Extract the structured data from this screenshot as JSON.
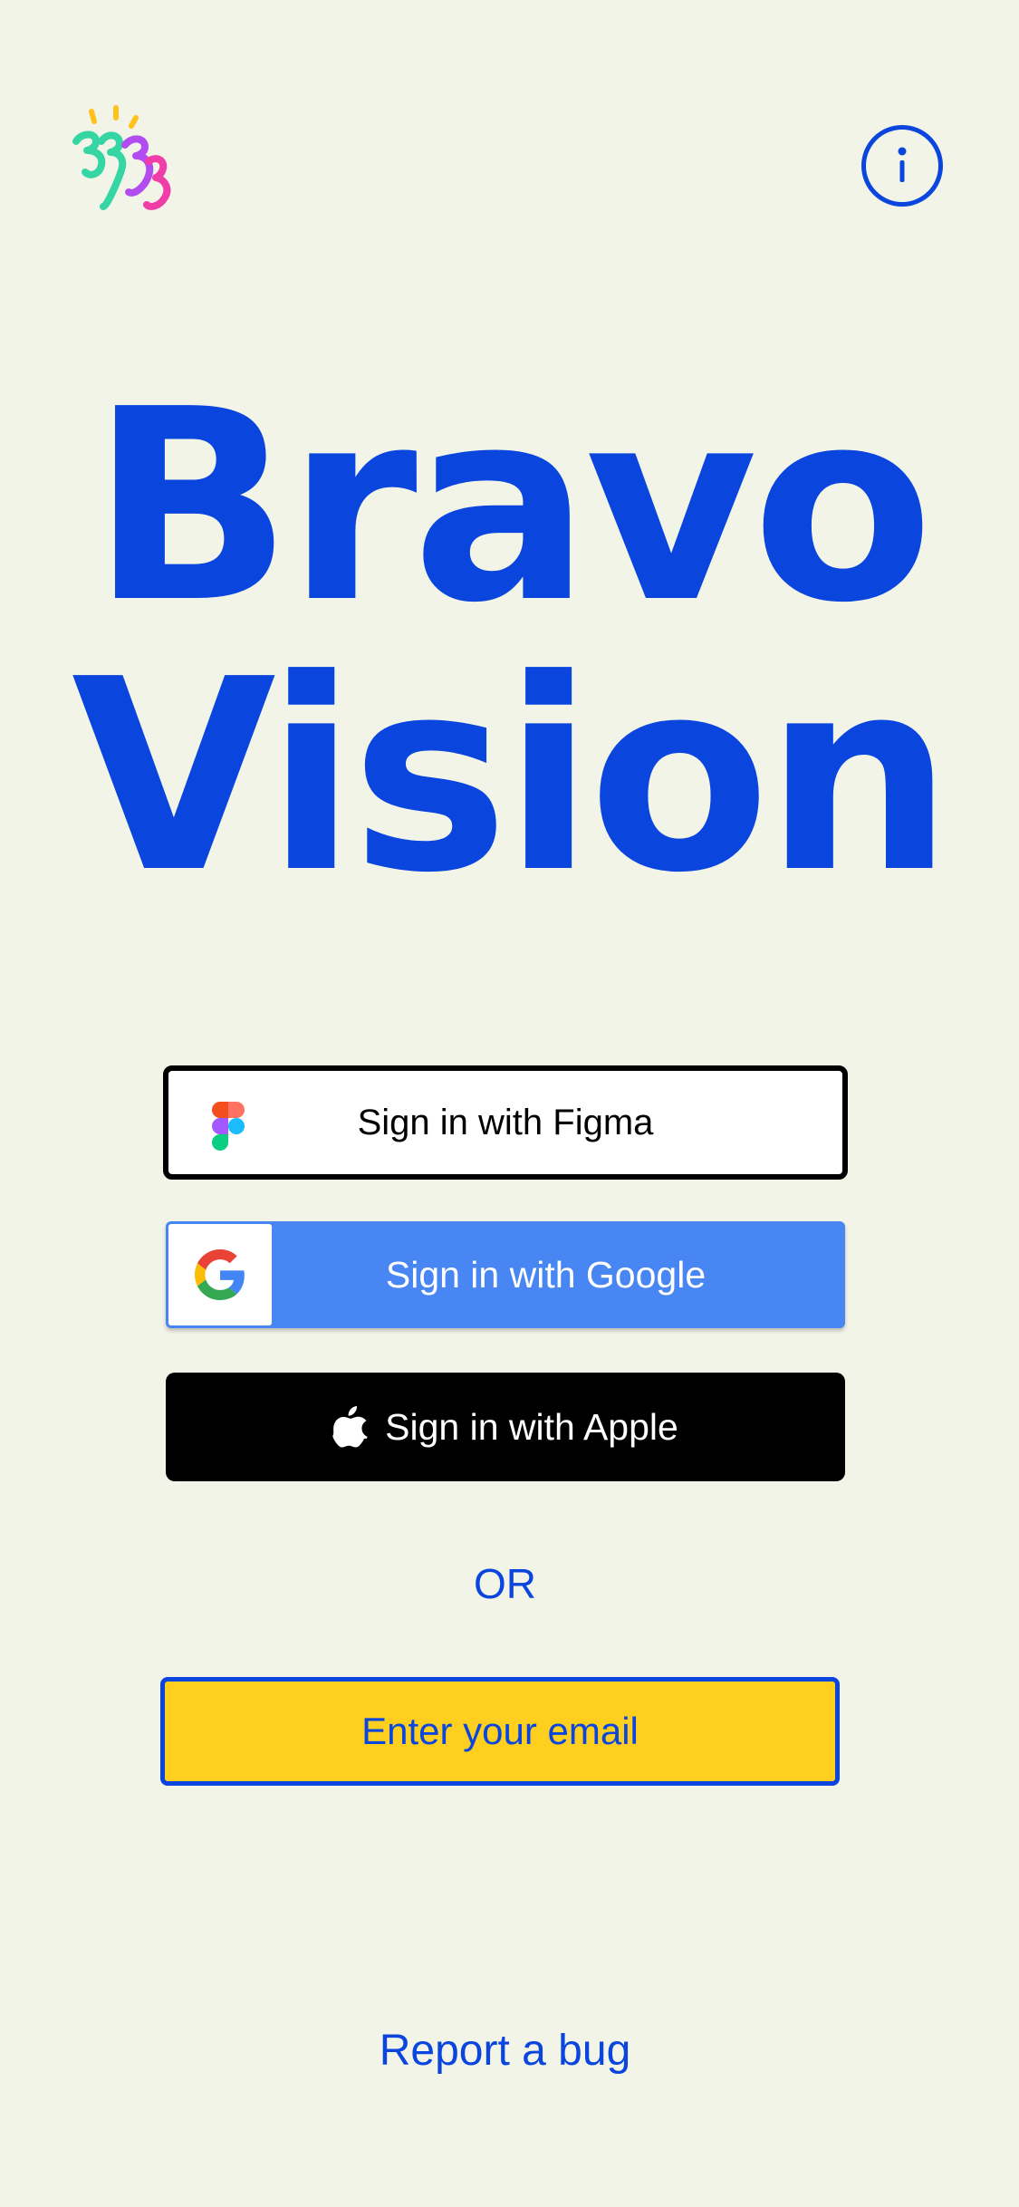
{
  "app": {
    "logo_icon": "squiggle-logo-icon",
    "info_icon": "info-icon"
  },
  "hero": {
    "line1": "Bravo",
    "line2": "Vision"
  },
  "auth": {
    "figma_label": "Sign in with Figma",
    "figma_icon": "figma-icon",
    "google_label": "Sign in with Google",
    "google_icon": "google-g-icon",
    "apple_label": "Sign in with Apple",
    "apple_icon": "apple-icon",
    "or_text": "OR",
    "email_label": "Enter your email"
  },
  "footer": {
    "report_label": "Report a bug"
  },
  "colors": {
    "background": "#f2f4e8",
    "brand_blue": "#0a45de",
    "google_blue": "#4786f3",
    "email_yellow": "#fecf1f",
    "apple_black": "#000000"
  }
}
